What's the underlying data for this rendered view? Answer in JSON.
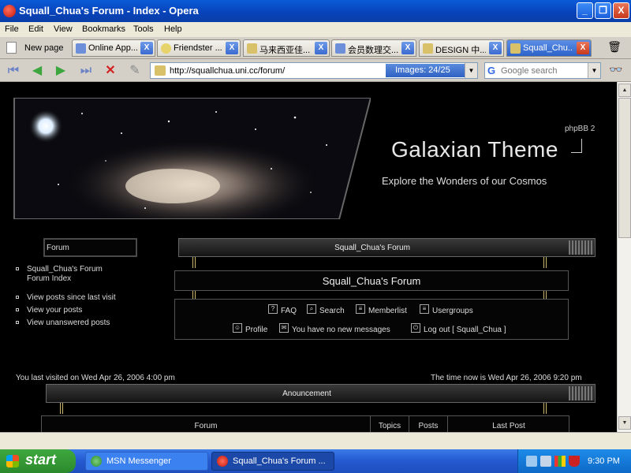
{
  "window": {
    "title": "Squall_Chua's Forum - Index - Opera",
    "minimize": "_",
    "maximize": "❐",
    "close": "X"
  },
  "menu": [
    "File",
    "Edit",
    "View",
    "Bookmarks",
    "Tools",
    "Help"
  ],
  "tabs": {
    "new_page": "New page",
    "items": [
      {
        "label": "Online App...",
        "active": false
      },
      {
        "label": "Friendster ...",
        "active": false
      },
      {
        "label": "马来西亚佳...",
        "active": false
      },
      {
        "label": "会员数理交...",
        "active": false
      },
      {
        "label": "DESIGN 中...",
        "active": false
      },
      {
        "label": "Squall_Chu...",
        "active": true
      }
    ]
  },
  "address": {
    "url": "http://squallchua.uni.cc/forum/",
    "images": "Images:  24/25",
    "search_placeholder": "Google search"
  },
  "header": {
    "phpbb": "phpBB 2",
    "title": "Galaxian Theme",
    "tagline": "Explore the Wonders of our Cosmos"
  },
  "sidebar": {
    "title": "Forum",
    "links": [
      "Squall_Chua's Forum Forum Index",
      "View posts since last visit",
      "View your posts",
      "View unanswered posts"
    ]
  },
  "main": {
    "bar_title": "Squall_Chua's Forum",
    "forum_name": "Squall_Chua's Forum",
    "nav_row1": [
      "FAQ",
      "Search",
      "Memberlist",
      "Usergroups"
    ],
    "nav_row2": [
      "Profile",
      "You have no new messages",
      "Log out [ Squall_Chua ]"
    ]
  },
  "visit": {
    "last": "You last visited on Wed Apr 26, 2006 4:00 pm",
    "now": "The time now is Wed Apr 26, 2006 9:20 pm"
  },
  "announcement": {
    "title": "Anouncement",
    "columns": [
      "Forum",
      "Topics",
      "Posts",
      "Last Post"
    ]
  },
  "taskbar": {
    "start": "start",
    "tasks": [
      "MSN Messenger",
      "Squall_Chua's Forum ..."
    ],
    "clock": "9:30 PM"
  }
}
